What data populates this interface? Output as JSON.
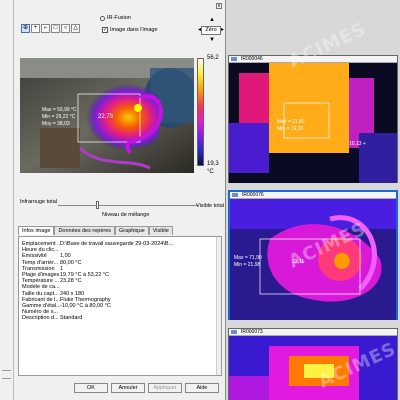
{
  "window": {
    "close_label": "x"
  },
  "toolbar": {
    "tools": [
      "⊕",
      "+",
      "⌐",
      "□",
      "○",
      "△"
    ]
  },
  "irfusion": {
    "label": "IR-Fusion",
    "checkbox_label": "Image dans l'image",
    "checked": true
  },
  "zoom": {
    "reset_label": "Zéro"
  },
  "thermal": {
    "readout_max": "Max = 59,99 °C",
    "readout_min": "Min = 29,22 °C",
    "readout_avg": "Moy = 38,03",
    "box_value": "22,73",
    "scale_max": "56,2",
    "scale_min": "19,3",
    "scale_unit": "°C"
  },
  "blend": {
    "left_label": "Infrarouge total",
    "right_label": "Visible total",
    "center_label": "Niveau de mélange",
    "level": 0.28
  },
  "tabs": [
    "Infos image",
    "Données des repères",
    "Graphique",
    "Visible"
  ],
  "info_rows": [
    {
      "k": "Emplacement ...",
      "v": "D:\\Base de travail sauvegarde 29-03-2024\\B..."
    },
    {
      "k": "Heure du clic...",
      "v": ""
    },
    {
      "k": "Emissivité",
      "v": "1,00"
    },
    {
      "k": "Temp d'arrièr...",
      "v": "80,00 °C"
    },
    {
      "k": "Transmission",
      "v": "1"
    },
    {
      "k": "Plage d'images",
      "v": "19,79 °C à 53,22 °C"
    },
    {
      "k": "Température ...",
      "v": "23,28 °C"
    },
    {
      "k": "Modèle de ca...",
      "v": ""
    },
    {
      "k": "Taille du capt...",
      "v": "240 x 180"
    },
    {
      "k": "Fabricant de l...",
      "v": "Fluke Thermography"
    },
    {
      "k": "Gamme d'étal...",
      "v": "-10,00 °C à 80,00 °C"
    },
    {
      "k": "Numéro de s...",
      "v": ""
    },
    {
      "k": "Description d...",
      "v": "Standard"
    }
  ],
  "buttons": {
    "ok": "OK",
    "cancel": "Annuler",
    "apply": "Appliquer",
    "help": "Aide"
  },
  "thumbnails": [
    {
      "name": "IR000046",
      "max": "Max = 21,82",
      "min": "Min = 19,10",
      "extra": "10,13 +",
      "selected": false
    },
    {
      "name": "IR000076",
      "max": "Max = 71,90",
      "min": "Min = 21,98",
      "extra": "22,11",
      "selected": true
    },
    {
      "name": "IR000073",
      "max": "",
      "min": "",
      "extra": "",
      "selected": false
    }
  ],
  "watermark": "ACIMES"
}
